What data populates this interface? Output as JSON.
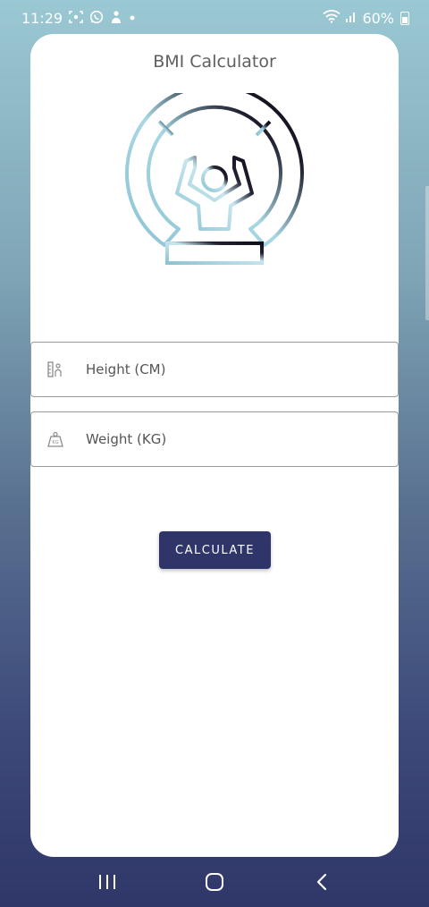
{
  "status_bar": {
    "time": "11:29",
    "battery": "60%",
    "icons": [
      "screenshot-icon",
      "whatsapp-icon",
      "app-notification-icon",
      "dot-icon",
      "wifi-icon",
      "signal-icon",
      "battery-icon"
    ]
  },
  "app": {
    "title": "BMI Calculator"
  },
  "form": {
    "height": {
      "placeholder": "Height (CM)",
      "value": ""
    },
    "weight": {
      "placeholder": "Weight (KG)",
      "value": ""
    }
  },
  "actions": {
    "calculate_label": "CALCULATE"
  },
  "colors": {
    "accent": "#2f3568",
    "logo_light": "#8cc3d4",
    "logo_dark": "#0c0c18"
  }
}
